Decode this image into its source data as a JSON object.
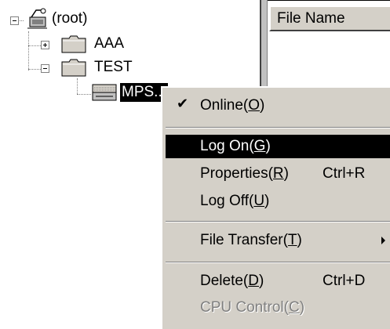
{
  "tree": {
    "root_label": "(root)",
    "nodes": [
      {
        "label": "AAA"
      },
      {
        "label": "TEST"
      },
      {
        "label": "MPS..."
      }
    ]
  },
  "list": {
    "column_header": "File Name"
  },
  "context_menu": {
    "online": {
      "label": "Online(",
      "mnemonic": "O",
      "close": ")",
      "checked": "✔"
    },
    "log_on": {
      "label": "Log On(",
      "mnemonic": "G",
      "close": ")"
    },
    "properties": {
      "label": "Properties(",
      "mnemonic": "R",
      "close": ")",
      "shortcut": "Ctrl+R"
    },
    "log_off": {
      "label": "Log Off(",
      "mnemonic": "U",
      "close": ")"
    },
    "file_transfer": {
      "label": "File Transfer(",
      "mnemonic": "T",
      "close": ")"
    },
    "delete": {
      "label": "Delete(",
      "mnemonic": "D",
      "close": ")",
      "shortcut": "Ctrl+D"
    },
    "cpu_control": {
      "label": "CPU Control(",
      "mnemonic": "C",
      "close": ")"
    }
  },
  "colors": {
    "menu_bg": "#d4d0c8",
    "highlight_bg": "#000000",
    "highlight_fg": "#ffffff",
    "disabled_fg": "#808080"
  }
}
